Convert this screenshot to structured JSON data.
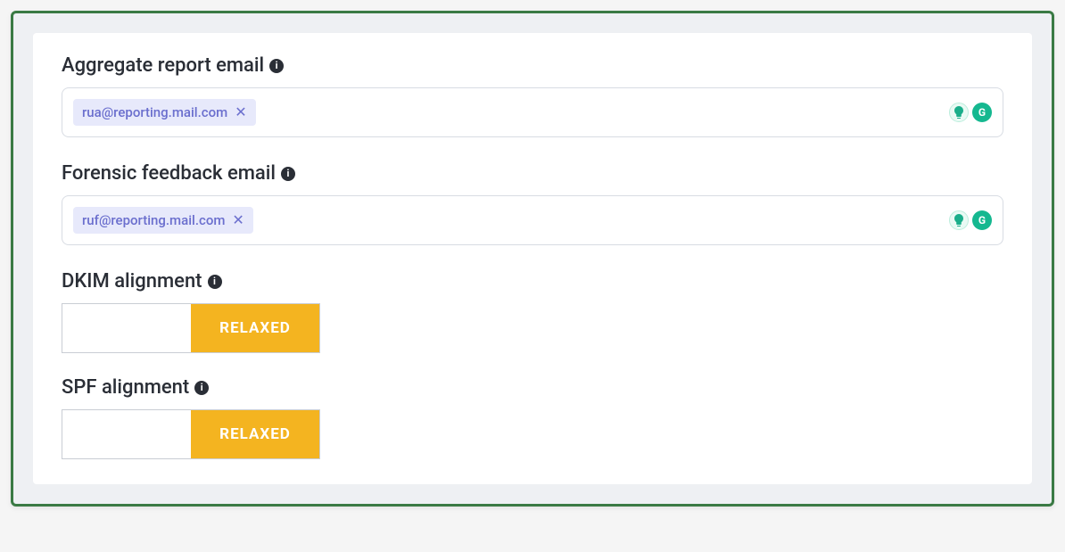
{
  "aggregate": {
    "label": "Aggregate report email",
    "chip": "rua@reporting.mail.com"
  },
  "forensic": {
    "label": "Forensic feedback email",
    "chip": "ruf@reporting.mail.com"
  },
  "dkim": {
    "label": "DKIM alignment",
    "options": {
      "left": "",
      "right": "RELAXED"
    }
  },
  "spf": {
    "label": "SPF alignment",
    "options": {
      "left": "",
      "right": "RELAXED"
    }
  },
  "icons": {
    "info": "i",
    "close": "✕",
    "bulb": "💡",
    "grammarly": "G"
  }
}
